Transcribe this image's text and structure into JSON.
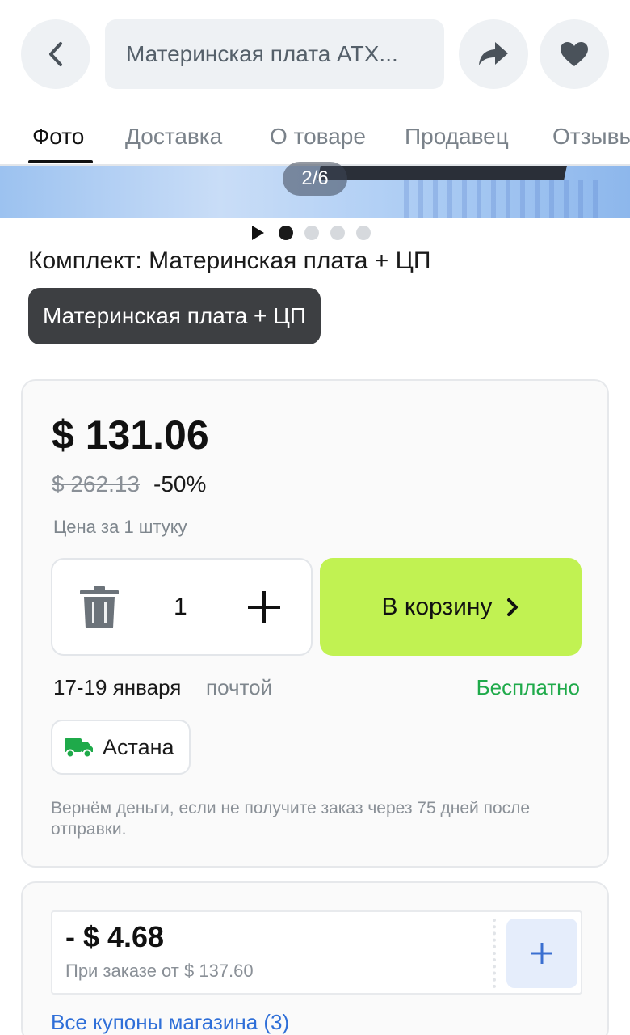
{
  "header": {
    "search_text": "Материнская плата ATX...",
    "back_icon": "chevron-left-icon",
    "share_icon": "share-arrow-icon",
    "favorite_icon": "heart-icon"
  },
  "tabs": [
    {
      "label": "Фото",
      "active": true
    },
    {
      "label": "Доставка",
      "active": false
    },
    {
      "label": "О товаре",
      "active": false
    },
    {
      "label": "Продавец",
      "active": false
    },
    {
      "label": "Отзывы",
      "active": false
    }
  ],
  "gallery": {
    "counter": "2/6",
    "dots_total": 4,
    "dot_active_index": 0
  },
  "variant": {
    "title": "Комплект: Материнская плата + ЦП",
    "selected_chip": "Материнская плата + ЦП"
  },
  "price_card": {
    "price": "$ 131.06",
    "old_price": "$ 262.13",
    "discount": "-50%",
    "unit_note": "Цена за 1 штуку",
    "quantity": "1",
    "cart_button": "В корзину",
    "delivery_date": "17-19 января",
    "delivery_method": "почтой",
    "delivery_cost": "Бесплатно",
    "city": "Астана",
    "refund_note": "Вернём деньги, если не получите заказ через 75 дней после отправки."
  },
  "coupon": {
    "amount": "- $ 4.68",
    "condition": "При заказе от $ 137.60",
    "all_coupons_link": "Все купоны магазина (3)"
  },
  "colors": {
    "accent_cart": "#c1f252",
    "free_delivery": "#1faa4a",
    "link": "#2f6fd8",
    "chip_dark": "#3d3f42"
  }
}
